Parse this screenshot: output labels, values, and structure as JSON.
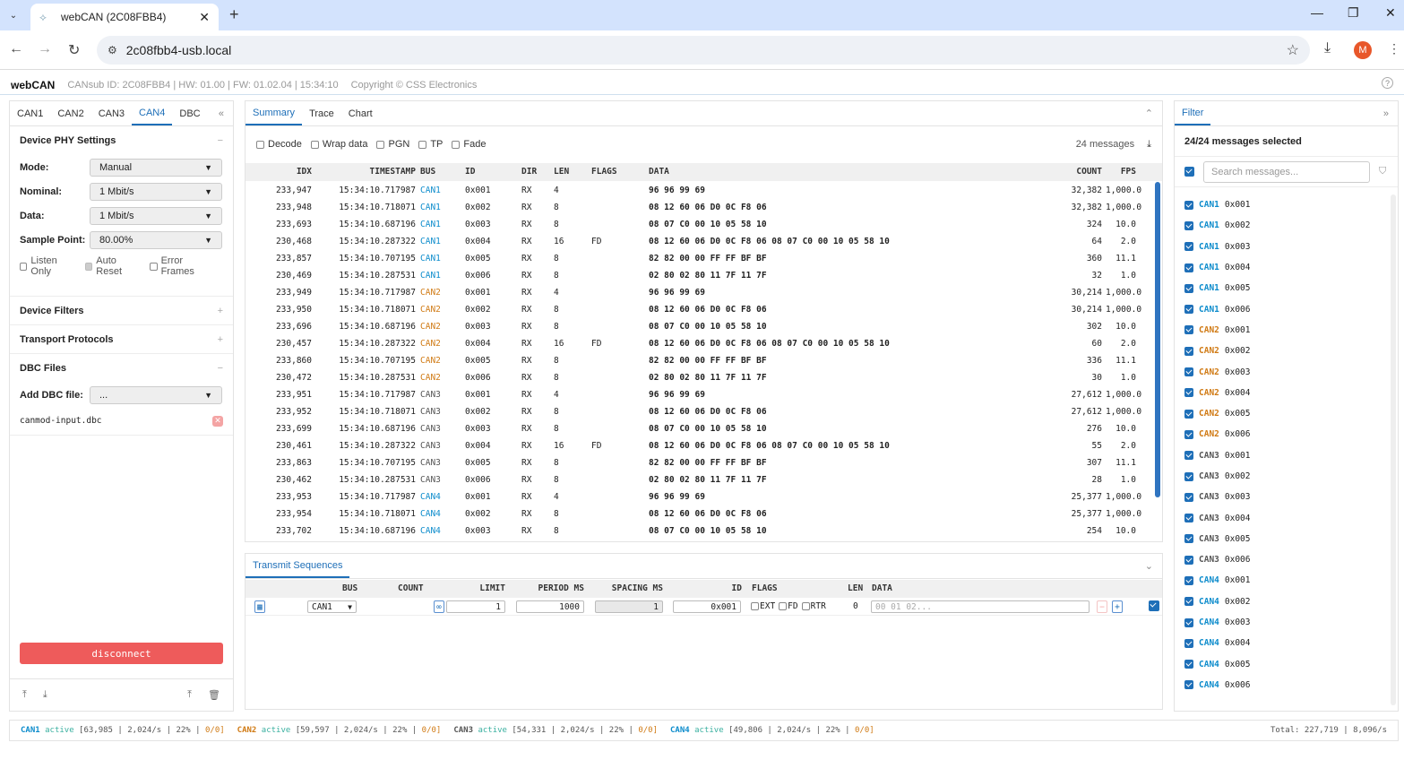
{
  "browser": {
    "tab_title": "webCAN (2C08FBB4)",
    "url": "2c08fbb4-usb.local",
    "avatar": "M"
  },
  "app": {
    "brand": "webCAN",
    "info": "CANsub ID: 2C08FBB4 | HW: 01.00 | FW: 01.02.04 | 15:34:10",
    "copyright": "Copyright © CSS Electronics"
  },
  "left": {
    "tabs": [
      "CAN1",
      "CAN2",
      "CAN3",
      "CAN4",
      "DBC"
    ],
    "phy_title": "Device PHY Settings",
    "mode_label": "Mode:",
    "mode_value": "Manual",
    "nominal_label": "Nominal:",
    "nominal_value": "1 Mbit/s",
    "data_label": "Data:",
    "data_value": "1 Mbit/s",
    "sample_label": "Sample Point:",
    "sample_value": "80.00%",
    "listen_only": "Listen Only",
    "auto_reset": "Auto Reset",
    "error_frames": "Error Frames",
    "filters_title": "Device Filters",
    "transport_title": "Transport Protocols",
    "dbc_title": "DBC Files",
    "add_dbc_label": "Add DBC file:",
    "add_dbc_value": "...",
    "dbc_file": "canmod-input.dbc",
    "disconnect": "disconnect"
  },
  "summary": {
    "tabs": [
      "Summary",
      "Trace",
      "Chart"
    ],
    "options": [
      "Decode",
      "Wrap data",
      "PGN",
      "TP",
      "Fade"
    ],
    "message_count": "24 messages",
    "columns": [
      "IDX",
      "TIMESTAMP",
      "BUS",
      "ID",
      "DIR",
      "LEN",
      "FLAGS",
      "DATA",
      "COUNT",
      "FPS"
    ],
    "rows": [
      [
        "233,947",
        "15:34:10.717987",
        "CAN1",
        "0x001",
        "RX",
        "4",
        "",
        "96 96 99 69",
        "32,382",
        "1,000.0"
      ],
      [
        "233,948",
        "15:34:10.718071",
        "CAN1",
        "0x002",
        "RX",
        "8",
        "",
        "08 12 60 06 D0 0C F8 06",
        "32,382",
        "1,000.0"
      ],
      [
        "233,693",
        "15:34:10.687196",
        "CAN1",
        "0x003",
        "RX",
        "8",
        "",
        "08 07 C0 00 10 05 58 10",
        "324",
        "10.0"
      ],
      [
        "230,468",
        "15:34:10.287322",
        "CAN1",
        "0x004",
        "RX",
        "16",
        "FD",
        "08 12 60 06 D0 0C F8 06 08 07 C0 00 10 05 58 10",
        "64",
        "2.0"
      ],
      [
        "233,857",
        "15:34:10.707195",
        "CAN1",
        "0x005",
        "RX",
        "8",
        "",
        "82 82 00 00 FF FF BF BF",
        "360",
        "11.1"
      ],
      [
        "230,469",
        "15:34:10.287531",
        "CAN1",
        "0x006",
        "RX",
        "8",
        "",
        "02 80 02 80 11 7F 11 7F",
        "32",
        "1.0"
      ],
      [
        "233,949",
        "15:34:10.717987",
        "CAN2",
        "0x001",
        "RX",
        "4",
        "",
        "96 96 99 69",
        "30,214",
        "1,000.0"
      ],
      [
        "233,950",
        "15:34:10.718071",
        "CAN2",
        "0x002",
        "RX",
        "8",
        "",
        "08 12 60 06 D0 0C F8 06",
        "30,214",
        "1,000.0"
      ],
      [
        "233,696",
        "15:34:10.687196",
        "CAN2",
        "0x003",
        "RX",
        "8",
        "",
        "08 07 C0 00 10 05 58 10",
        "302",
        "10.0"
      ],
      [
        "230,457",
        "15:34:10.287322",
        "CAN2",
        "0x004",
        "RX",
        "16",
        "FD",
        "08 12 60 06 D0 0C F8 06 08 07 C0 00 10 05 58 10",
        "60",
        "2.0"
      ],
      [
        "233,860",
        "15:34:10.707195",
        "CAN2",
        "0x005",
        "RX",
        "8",
        "",
        "82 82 00 00 FF FF BF BF",
        "336",
        "11.1"
      ],
      [
        "230,472",
        "15:34:10.287531",
        "CAN2",
        "0x006",
        "RX",
        "8",
        "",
        "02 80 02 80 11 7F 11 7F",
        "30",
        "1.0"
      ],
      [
        "233,951",
        "15:34:10.717987",
        "CAN3",
        "0x001",
        "RX",
        "4",
        "",
        "96 96 99 69",
        "27,612",
        "1,000.0"
      ],
      [
        "233,952",
        "15:34:10.718071",
        "CAN3",
        "0x002",
        "RX",
        "8",
        "",
        "08 12 60 06 D0 0C F8 06",
        "27,612",
        "1,000.0"
      ],
      [
        "233,699",
        "15:34:10.687196",
        "CAN3",
        "0x003",
        "RX",
        "8",
        "",
        "08 07 C0 00 10 05 58 10",
        "276",
        "10.0"
      ],
      [
        "230,461",
        "15:34:10.287322",
        "CAN3",
        "0x004",
        "RX",
        "16",
        "FD",
        "08 12 60 06 D0 0C F8 06 08 07 C0 00 10 05 58 10",
        "55",
        "2.0"
      ],
      [
        "233,863",
        "15:34:10.707195",
        "CAN3",
        "0x005",
        "RX",
        "8",
        "",
        "82 82 00 00 FF FF BF BF",
        "307",
        "11.1"
      ],
      [
        "230,462",
        "15:34:10.287531",
        "CAN3",
        "0x006",
        "RX",
        "8",
        "",
        "02 80 02 80 11 7F 11 7F",
        "28",
        "1.0"
      ],
      [
        "233,953",
        "15:34:10.717987",
        "CAN4",
        "0x001",
        "RX",
        "4",
        "",
        "96 96 99 69",
        "25,377",
        "1,000.0"
      ],
      [
        "233,954",
        "15:34:10.718071",
        "CAN4",
        "0x002",
        "RX",
        "8",
        "",
        "08 12 60 06 D0 0C F8 06",
        "25,377",
        "1,000.0"
      ],
      [
        "233,702",
        "15:34:10.687196",
        "CAN4",
        "0x003",
        "RX",
        "8",
        "",
        "08 07 C0 00 10 05 58 10",
        "254",
        "10.0"
      ]
    ]
  },
  "transmit": {
    "title": "Transmit Sequences",
    "columns": [
      "BUS",
      "COUNT",
      "LIMIT",
      "PERIOD MS",
      "SPACING MS",
      "ID",
      "FLAGS",
      "LEN",
      "DATA"
    ],
    "bus": "CAN1",
    "limit": "1",
    "period": "1000",
    "spacing": "1",
    "id": "0x001",
    "flag_ext": "EXT",
    "flag_fd": "FD",
    "flag_rtr": "RTR",
    "len": "0",
    "data_placeholder": "00 01 02..."
  },
  "filter": {
    "title": "Filter",
    "selected": "24/24 messages selected",
    "search_placeholder": "Search messages...",
    "items": [
      [
        "CAN1",
        "0x001"
      ],
      [
        "CAN1",
        "0x002"
      ],
      [
        "CAN1",
        "0x003"
      ],
      [
        "CAN1",
        "0x004"
      ],
      [
        "CAN1",
        "0x005"
      ],
      [
        "CAN1",
        "0x006"
      ],
      [
        "CAN2",
        "0x001"
      ],
      [
        "CAN2",
        "0x002"
      ],
      [
        "CAN2",
        "0x003"
      ],
      [
        "CAN2",
        "0x004"
      ],
      [
        "CAN2",
        "0x005"
      ],
      [
        "CAN2",
        "0x006"
      ],
      [
        "CAN3",
        "0x001"
      ],
      [
        "CAN3",
        "0x002"
      ],
      [
        "CAN3",
        "0x003"
      ],
      [
        "CAN3",
        "0x004"
      ],
      [
        "CAN3",
        "0x005"
      ],
      [
        "CAN3",
        "0x006"
      ],
      [
        "CAN4",
        "0x001"
      ],
      [
        "CAN4",
        "0x002"
      ],
      [
        "CAN4",
        "0x003"
      ],
      [
        "CAN4",
        "0x004"
      ],
      [
        "CAN4",
        "0x005"
      ],
      [
        "CAN4",
        "0x006"
      ]
    ]
  },
  "status": {
    "buses": [
      {
        "bus": "CAN1",
        "state": "active",
        "count": "[63,985",
        "rate": "2,024/s",
        "load": "22%",
        "errors": "0/0]"
      },
      {
        "bus": "CAN2",
        "state": "active",
        "count": "[59,597",
        "rate": "2,024/s",
        "load": "22%",
        "errors": "0/0]"
      },
      {
        "bus": "CAN3",
        "state": "active",
        "count": "[54,331",
        "rate": "2,024/s",
        "load": "22%",
        "errors": "0/0]"
      },
      {
        "bus": "CAN4",
        "state": "active",
        "count": "[49,806",
        "rate": "2,024/s",
        "load": "22%",
        "errors": "0/0]"
      }
    ],
    "total": "Total: 227,719 | 8,096/s"
  },
  "colors": {
    "accent": "#1e6fb8",
    "can1": "#0d8ccc",
    "can2": "#d07a14",
    "can4": "#0d8ccc",
    "disconnect": "#ee5b5b"
  }
}
